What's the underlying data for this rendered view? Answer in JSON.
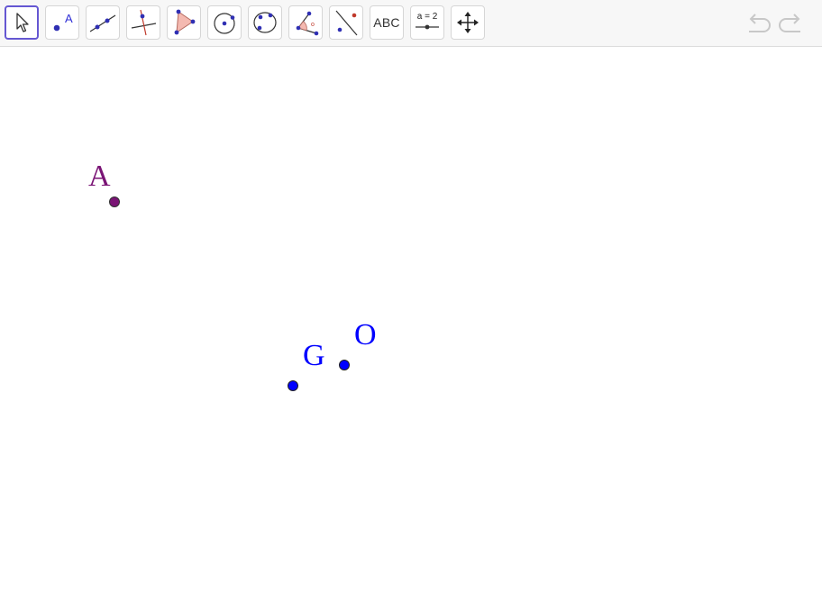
{
  "toolbar": {
    "text_tool_label": "ABC",
    "slider_tool_label": "a = 2",
    "point_tool_label": "A"
  },
  "points": [
    {
      "label": "A",
      "color": "#7a1475",
      "fill": "#7a1475"
    },
    {
      "label": "G",
      "color": "#0000ff",
      "fill": "#0000ff"
    },
    {
      "label": "O",
      "color": "#0000ff",
      "fill": "#0000ff"
    }
  ],
  "colors": {
    "accent": "#6557d2",
    "point_blue": "#0000ff",
    "point_purple": "#7a1475",
    "polygon_fill": "#f4b9b0",
    "polygon_edge": "#b56a5f"
  }
}
